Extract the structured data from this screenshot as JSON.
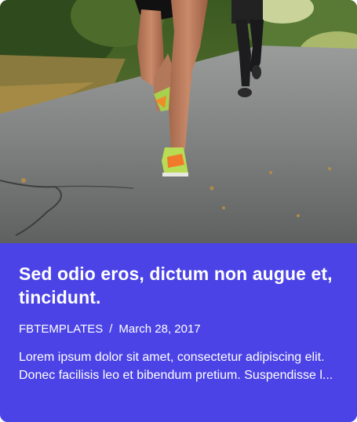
{
  "post": {
    "title": "Sed odio eros, dictum non augue et, tincidunt.",
    "author": "FBTEMPLATES",
    "separator": "/",
    "date": "March 28, 2017",
    "excerpt": "Lorem ipsum dolor sit amet, consectetur adipiscing elit. Donec facilisis leo et bibendum pretium. Suspendisse l..."
  },
  "colors": {
    "card_background": "#4b43e6",
    "text": "#ffffff"
  }
}
